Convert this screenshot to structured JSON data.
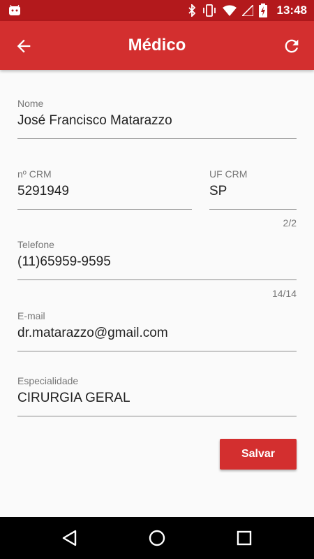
{
  "status_bar": {
    "time": "13:48",
    "icons": [
      "android-icon",
      "bluetooth-icon",
      "vibrate-icon",
      "wifi-icon",
      "signal-icon",
      "battery-icon"
    ]
  },
  "app_bar": {
    "title": "Médico",
    "back_icon": "arrow-back-icon",
    "refresh_icon": "refresh-icon"
  },
  "form": {
    "nome": {
      "label": "Nome",
      "value": "José Francisco Matarazzo"
    },
    "crm": {
      "label": "nº CRM",
      "value": "5291949"
    },
    "uf_crm": {
      "label": "UF CRM",
      "value": "SP",
      "counter": "2/2"
    },
    "telefone": {
      "label": "Telefone",
      "value": "(11)65959-9595",
      "counter": "14/14"
    },
    "email": {
      "label": "E-mail",
      "value": "dr.matarazzo@gmail.com"
    },
    "especialidade": {
      "label": "Especialidade",
      "value": "CIRURGIA GERAL"
    }
  },
  "actions": {
    "save_label": "Salvar"
  },
  "colors": {
    "primary": "#d32f2f",
    "primary_dark": "#b3191c"
  }
}
